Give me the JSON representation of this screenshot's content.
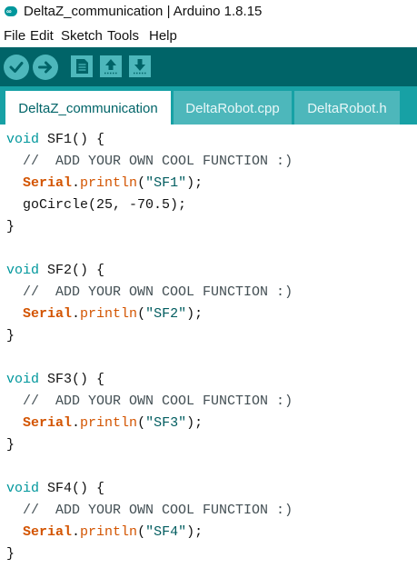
{
  "window": {
    "title": "DeltaZ_communication | Arduino 1.8.15"
  },
  "menu": [
    "File",
    "Edit",
    "Sketch",
    "Tools",
    "Help"
  ],
  "toolbar": [
    "verify-icon",
    "upload-icon",
    "new-icon",
    "open-icon",
    "save-icon"
  ],
  "tabs": [
    "DeltaZ_communication",
    "DeltaRobot.cpp",
    "DeltaRobot.h"
  ],
  "code": {
    "kw_void": "void",
    "comment": "//  ADD YOUR OWN COOL FUNCTION :)",
    "serial": "Serial",
    "println": "println",
    "f1": {
      "sig": " SF1() {",
      "str": "\"SF1\""
    },
    "f1_extra": "goCircle(25, -70.5);",
    "f2": {
      "sig": " SF2() {",
      "str": "\"SF2\""
    },
    "f3": {
      "sig": " SF3() {",
      "str": "\"SF3\""
    },
    "f4": {
      "sig": " SF4() {",
      "str": "\"SF4\""
    }
  },
  "colors": {
    "toolbar": "#006468",
    "tabbar": "#17a1a5",
    "keyword": "#00979c",
    "library": "#d35400"
  }
}
